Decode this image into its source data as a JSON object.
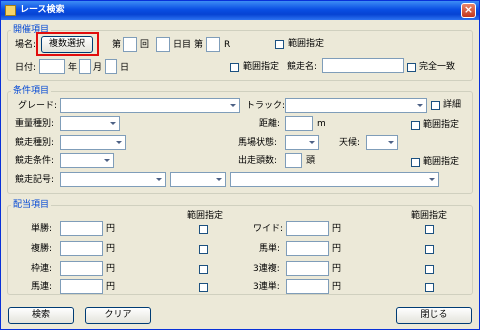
{
  "window": {
    "title": "レース検索",
    "close": "×"
  },
  "kaisai": {
    "group_label": "開催項目",
    "jomei_label": "場名:",
    "jomei_button": "複数選択",
    "dai1": "第",
    "kai": "回",
    "nichime": "日目",
    "dai2": "第",
    "race": "R",
    "range_label": "範囲指定",
    "date_label": "日付:",
    "nen": "年",
    "tsuki": "月",
    "hi": "日",
    "range_label2": "範囲指定",
    "kyosomei_label": "競走名:",
    "exact_label": "完全一致"
  },
  "joken": {
    "group_label": "条件項目",
    "grade_label": "グレード:",
    "track_label": "トラック:",
    "detail_label": "詳細",
    "juryo_label": "重量種別:",
    "kyori_label": "距離:",
    "kyori_unit": "m",
    "kyori_range": "範囲指定",
    "kyoso_shubetsu_label": "競走種別:",
    "baba_label": "馬場状態:",
    "tenko_label": "天候:",
    "kyoso_joken_label": "競走条件:",
    "tosu_label": "出走頭数:",
    "tosu_unit": "頭",
    "tosu_range": "範囲指定",
    "kigo_label": "競走記号:"
  },
  "haito": {
    "group_label": "配当項目",
    "range_header_left": "範囲指定",
    "range_header_right": "範囲指定",
    "left_rows": [
      {
        "label": "単勝:",
        "unit": "円"
      },
      {
        "label": "複勝:",
        "unit": "円"
      },
      {
        "label": "枠連:",
        "unit": "円"
      },
      {
        "label": "馬連:",
        "unit": "円"
      }
    ],
    "right_rows": [
      {
        "label": "ワイド:",
        "unit": "円"
      },
      {
        "label": "馬単:",
        "unit": "円"
      },
      {
        "label": "3連複:",
        "unit": "円"
      },
      {
        "label": "3連単:",
        "unit": "円"
      }
    ]
  },
  "footer": {
    "search": "検索",
    "clear": "クリア",
    "close": "閉じる"
  }
}
